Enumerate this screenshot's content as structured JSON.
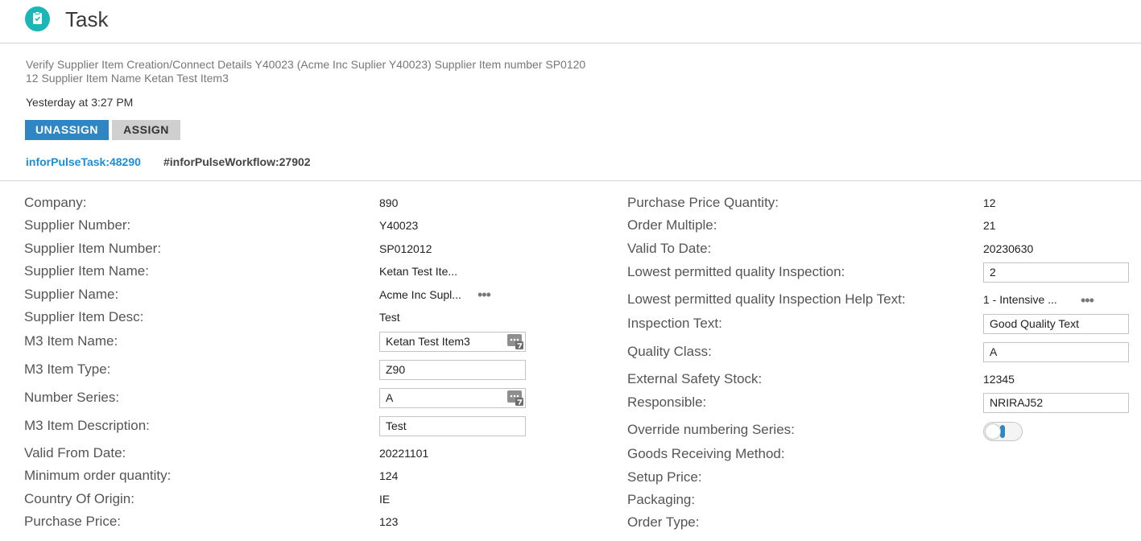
{
  "header": {
    "title": "Task",
    "icon": "clipboard-icon"
  },
  "task": {
    "description_line1": "Verify Supplier Item Creation/Connect Details Y40023 (Acme Inc Suplier Y40023) Supplier Item number SP0120",
    "description_line2": "12 Supplier Item Name Ketan Test Item3",
    "timestamp": "Yesterday at 3:27 PM"
  },
  "buttons": {
    "unassign": "UNASSIGN",
    "assign": "ASSIGN"
  },
  "tags": {
    "task": "inforPulseTask:48290",
    "workflow": "#inforPulseWorkflow:27902"
  },
  "left_fields": [
    {
      "label": "Company:",
      "value": "890"
    },
    {
      "label": "Supplier Number:",
      "value": "Y40023"
    },
    {
      "label": "Supplier Item Number:",
      "value": "SP012012"
    },
    {
      "label": "Supplier Item Name:",
      "value": "Ketan Test Ite..."
    },
    {
      "label": "Supplier Name:",
      "value": "Acme Inc Supl..."
    },
    {
      "label": "Supplier Item Desc:",
      "value": "Test"
    },
    {
      "label": "M3 Item Name:",
      "value": "Ketan Test Item3"
    },
    {
      "label": "M3 Item Type:",
      "value": "Z90"
    },
    {
      "label": "Number Series:",
      "value": "A"
    },
    {
      "label": "M3 Item Description:",
      "value": "Test"
    },
    {
      "label": "Valid From Date:",
      "value": "20221101"
    },
    {
      "label": "Minimum order quantity:",
      "value": "124"
    },
    {
      "label": "Country Of Origin:",
      "value": "IE"
    },
    {
      "label": "Purchase Price:",
      "value": "123"
    }
  ],
  "right_fields": [
    {
      "label": "Purchase Price Quantity:",
      "value": "12"
    },
    {
      "label": "Order Multiple:",
      "value": "21"
    },
    {
      "label": "Valid To Date:",
      "value": "20230630"
    },
    {
      "label": "Lowest permitted quality Inspection:",
      "value": "2"
    },
    {
      "label": "Lowest permitted quality Inspection Help Text:",
      "value": "1 - Intensive ..."
    },
    {
      "label": "Inspection Text:",
      "value": "Good Quality Text"
    },
    {
      "label": "Quality Class:",
      "value": "A"
    },
    {
      "label": "External Safety Stock:",
      "value": "12345"
    },
    {
      "label": "Responsible:",
      "value": "NRIRAJ52"
    },
    {
      "label": "Override numbering Series:",
      "value": ""
    },
    {
      "label": "Goods Receiving Method:",
      "value": ""
    },
    {
      "label": "Setup Price:",
      "value": ""
    },
    {
      "label": "Packaging:",
      "value": ""
    },
    {
      "label": "Order Type:",
      "value": ""
    }
  ],
  "more_glyph": "•••",
  "colors": {
    "accent": "#2f86c2",
    "link": "#1a8fd6",
    "icon_teal": "#1ab7b6"
  }
}
